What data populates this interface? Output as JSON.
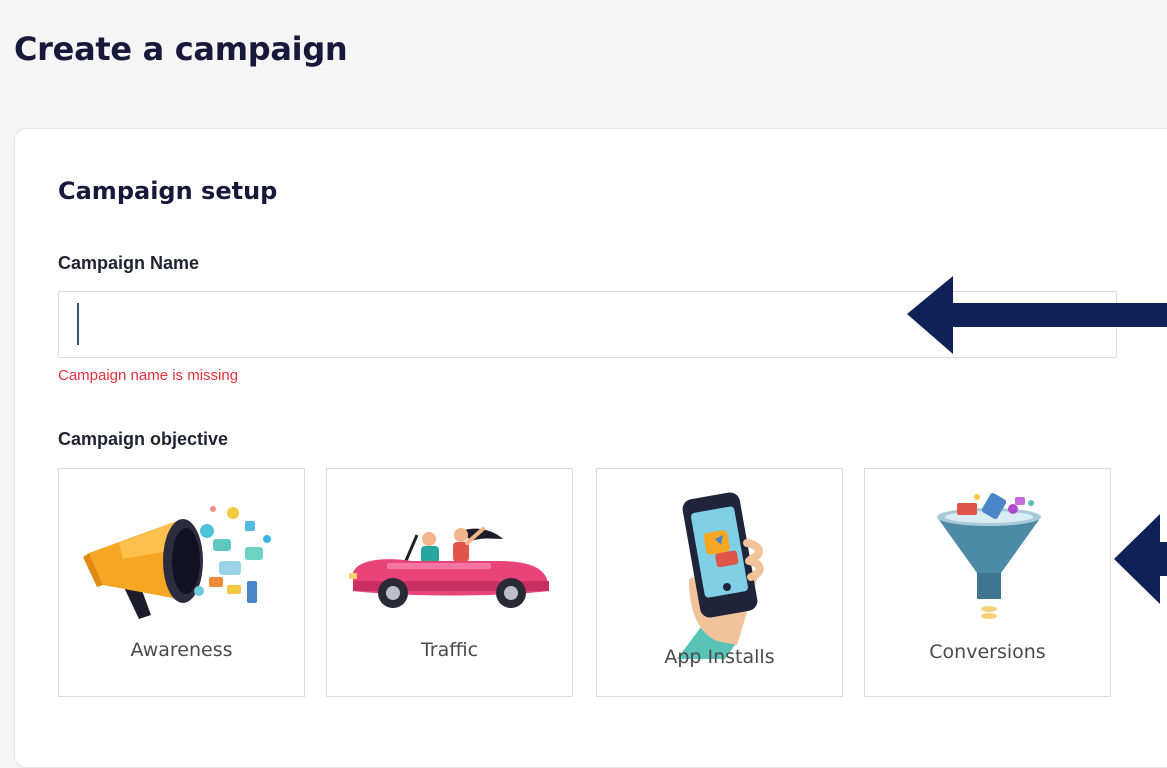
{
  "page": {
    "title": "Create a campaign"
  },
  "setup": {
    "title": "Campaign setup",
    "name_label": "Campaign Name",
    "name_value": "",
    "name_error": "Campaign name is missing",
    "objective_label": "Campaign objective",
    "objectives": [
      {
        "label": "Awareness",
        "icon": "megaphone-icon"
      },
      {
        "label": "Traffic",
        "icon": "convertible-car-icon"
      },
      {
        "label": "App Installs",
        "icon": "smartphone-icon"
      },
      {
        "label": "Conversions",
        "icon": "funnel-icon"
      }
    ]
  },
  "colors": {
    "error": "#e3303f",
    "arrow": "#0e2257"
  }
}
